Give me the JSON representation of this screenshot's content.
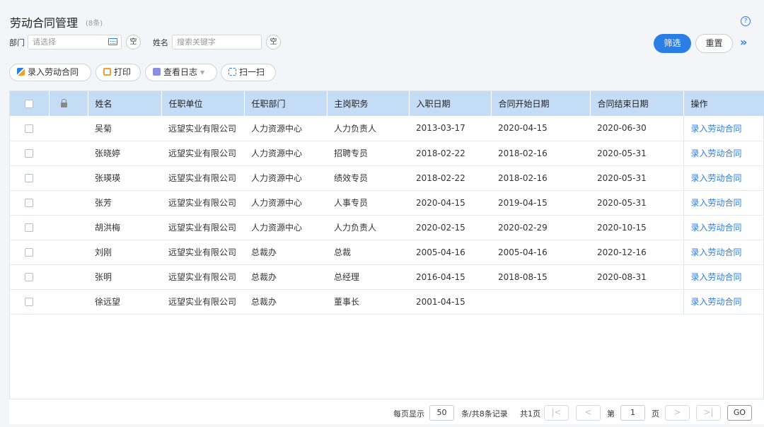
{
  "header": {
    "title": "劳动合同管理",
    "count": "(8条)",
    "help_icon": "?"
  },
  "filters": {
    "dept_label": "部门",
    "dept_placeholder": "请选择",
    "empty_label": "空",
    "name_label": "姓名",
    "name_placeholder": "搜索关键字",
    "filter_button": "筛选",
    "reset_button": "重置",
    "expand_icon": "»"
  },
  "toolbar": {
    "add_contract": "录入劳动合同",
    "print": "打印",
    "view_log": "查看日志",
    "scan": "扫一扫"
  },
  "table": {
    "columns": [
      "姓名",
      "任职单位",
      "任职部门",
      "主岗职务",
      "入职日期",
      "合同开始日期",
      "合同结束日期",
      "操作"
    ],
    "rows": [
      {
        "name": "吴菊",
        "company": "远望实业有限公司",
        "dept": "人力资源中心",
        "position": "人力负责人",
        "hire_date": "2013-03-17",
        "start": "2020-04-15",
        "end": "2020-06-30",
        "action": "录入劳动合同"
      },
      {
        "name": "张晓婷",
        "company": "远望实业有限公司",
        "dept": "人力资源中心",
        "position": "招聘专员",
        "hire_date": "2018-02-22",
        "start": "2018-02-16",
        "end": "2020-05-31",
        "action": "录入劳动合同"
      },
      {
        "name": "张瑛瑛",
        "company": "远望实业有限公司",
        "dept": "人力资源中心",
        "position": "绩效专员",
        "hire_date": "2018-02-22",
        "start": "2018-02-16",
        "end": "2020-05-31",
        "action": "录入劳动合同"
      },
      {
        "name": "张芳",
        "company": "远望实业有限公司",
        "dept": "人力资源中心",
        "position": "人事专员",
        "hire_date": "2020-04-15",
        "start": "2019-04-15",
        "end": "2020-05-31",
        "action": "录入劳动合同"
      },
      {
        "name": "胡洪梅",
        "company": "远望实业有限公司",
        "dept": "人力资源中心",
        "position": "人力负责人",
        "hire_date": "2020-02-15",
        "start": "2020-02-29",
        "end": "2020-10-15",
        "action": "录入劳动合同"
      },
      {
        "name": "刘刚",
        "company": "远望实业有限公司",
        "dept": "总裁办",
        "position": "总裁",
        "hire_date": "2005-04-16",
        "start": "2005-04-16",
        "end": "2020-12-16",
        "action": "录入劳动合同"
      },
      {
        "name": "张明",
        "company": "远望实业有限公司",
        "dept": "总裁办",
        "position": "总经理",
        "hire_date": "2016-04-15",
        "start": "2018-08-15",
        "end": "2020-08-31",
        "action": "录入劳动合同"
      },
      {
        "name": "徐远望",
        "company": "远望实业有限公司",
        "dept": "总裁办",
        "position": "董事长",
        "hire_date": "2001-04-15",
        "start": "",
        "end": "",
        "action": "录入劳动合同"
      }
    ]
  },
  "pager": {
    "per_page_label": "每页显示",
    "per_page_value": "50",
    "records_label": "条/共8条记录",
    "total_pages": "共1页",
    "page_prefix": "第",
    "page_value": "1",
    "page_suffix": "页",
    "go_label": "GO",
    "first_icon": "|<",
    "prev_icon": "<",
    "next_icon": ">",
    "last_icon": ">|"
  }
}
